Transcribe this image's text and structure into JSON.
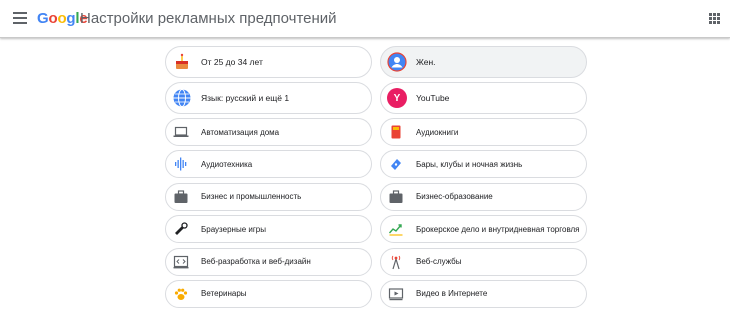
{
  "header": {
    "logo": [
      "G",
      "o",
      "o",
      "g",
      "l",
      "e"
    ],
    "logo_colors": [
      "#4285F4",
      "#EA4335",
      "#FBBC05",
      "#4285F4",
      "#34A853",
      "#EA4335"
    ],
    "title": "Настройки рекламных предпочтений"
  },
  "cards": [
    {
      "label": "От 25 до 34 лет",
      "icon": "cake-icon"
    },
    {
      "label": "Жен.",
      "icon": "person-icon"
    },
    {
      "label": "Язык: русский и ещё 1",
      "icon": "globe-icon"
    },
    {
      "label": "YouTube",
      "icon": "Y",
      "badge": "Y"
    },
    {
      "label": "Автоматизация дома",
      "icon": "laptop-icon"
    },
    {
      "label": "Аудиокниги",
      "icon": "book-icon"
    },
    {
      "label": "Аудиотехника",
      "icon": "audio-wave-icon"
    },
    {
      "label": "Бары, клубы и ночная жизнь",
      "icon": "ticket-icon"
    },
    {
      "label": "Бизнес и промышленность",
      "icon": "briefcase-icon"
    },
    {
      "label": "Бизнес-образование",
      "icon": "briefcase-icon"
    },
    {
      "label": "Браузерные игры",
      "icon": "gamepad-icon"
    },
    {
      "label": "Брокерское дело и внутридневная торговля",
      "icon": "trend-chart-icon"
    },
    {
      "label": "Веб-разработка и веб-дизайн",
      "icon": "code-window-icon"
    },
    {
      "label": "Веб-службы",
      "icon": "antenna-icon"
    },
    {
      "label": "Ветеринары",
      "icon": "paw-icon"
    },
    {
      "label": "Видео в Интернете",
      "icon": "video-player-icon"
    }
  ]
}
